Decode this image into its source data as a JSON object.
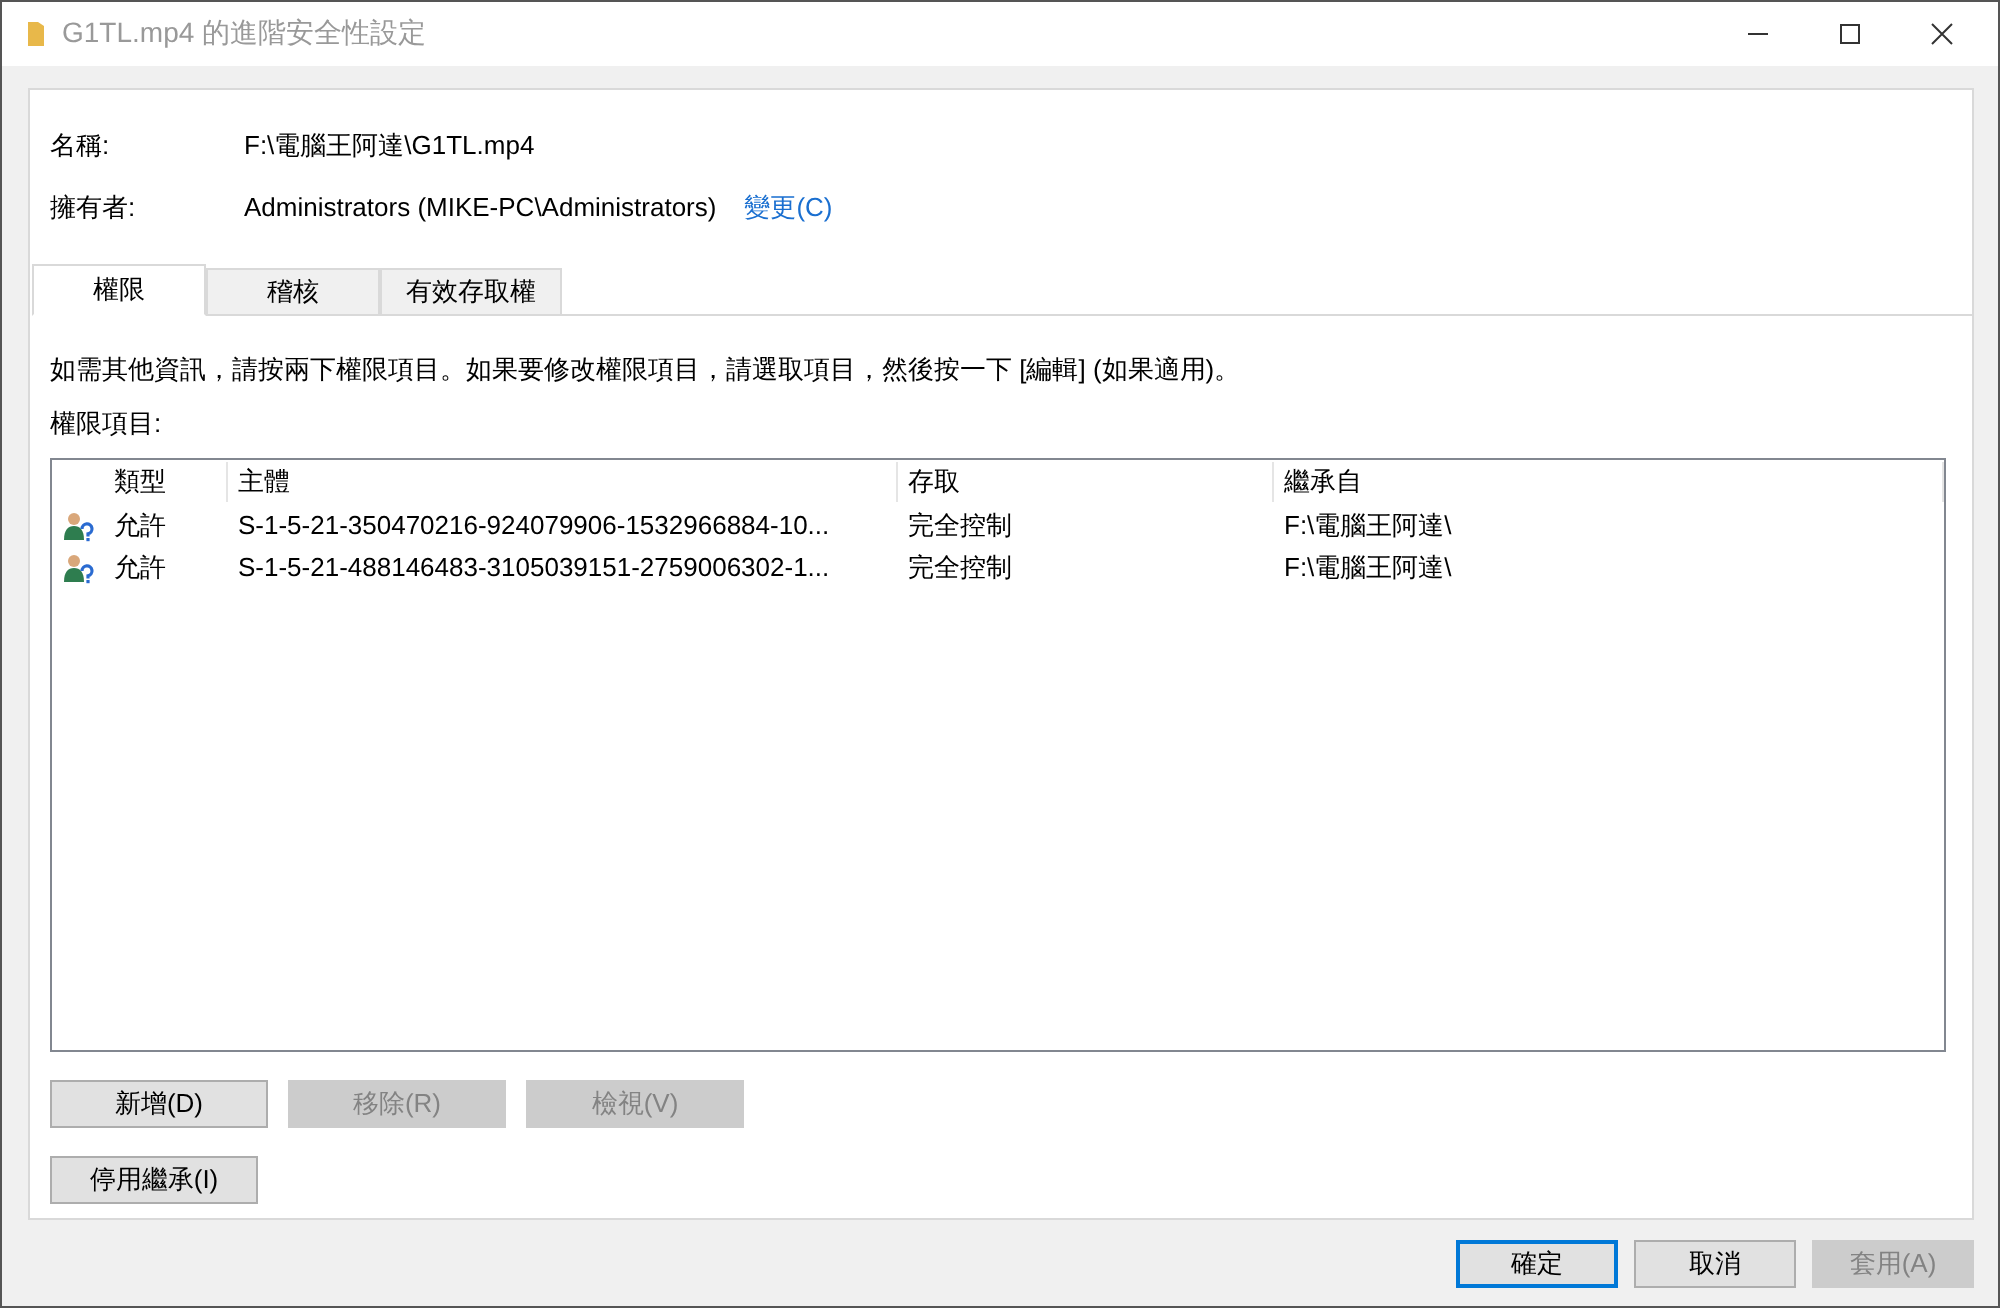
{
  "window": {
    "title": "G1TL.mp4 的進階安全性設定"
  },
  "fields": [
    {
      "label": "名稱:",
      "value": "F:\\電腦王阿達\\G1TL.mp4"
    },
    {
      "label": "擁有者:",
      "value": "Administrators (MIKE-PC\\Administrators)",
      "link": "變更(C)"
    }
  ],
  "tabs": [
    {
      "label": "權限",
      "selected": true
    },
    {
      "label": "稽核",
      "selected": false
    },
    {
      "label": "有效存取權",
      "selected": false
    }
  ],
  "info": "如需其他資訊，請按兩下權限項目。如果要修改權限項目，請選取項目，然後按一下 [編輯] (如果適用)。",
  "list_label": "權限項目:",
  "table": {
    "columns": [
      "類型",
      "主體",
      "存取",
      "繼承自"
    ],
    "rows": [
      {
        "cells": [
          "允許",
          "S-1-5-21-350470216-924079906-1532966884-10...",
          "完全控制",
          "F:\\電腦王阿達\\"
        ]
      },
      {
        "cells": [
          "允許",
          "S-1-5-21-488146483-3105039151-2759006302-1...",
          "完全控制",
          "F:\\電腦王阿達\\"
        ]
      }
    ]
  },
  "buttons": [
    {
      "label": "新增(D)",
      "disabled": false
    },
    {
      "label": "移除(R)",
      "disabled": true
    },
    {
      "label": "檢視(V)",
      "disabled": true
    }
  ],
  "inherit_button": {
    "label": "停用繼承(I)",
    "disabled": false
  },
  "dialog_buttons": [
    {
      "label": "確定",
      "disabled": false,
      "default": true
    },
    {
      "label": "取消",
      "disabled": false,
      "default": false
    },
    {
      "label": "套用(A)",
      "disabled": true,
      "default": false
    }
  ]
}
